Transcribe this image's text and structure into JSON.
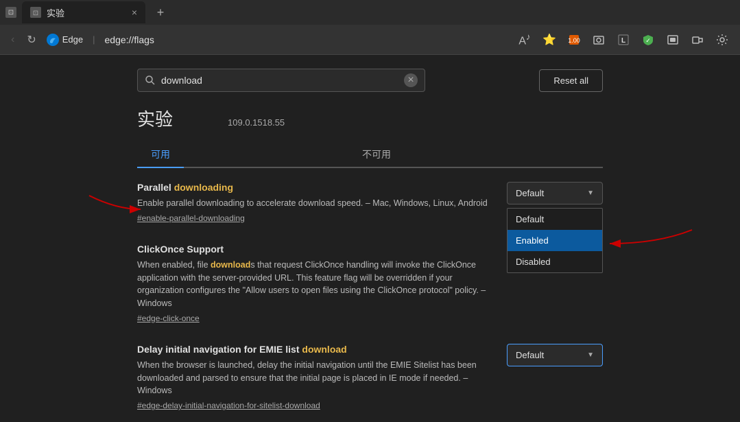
{
  "titleBar": {
    "tabTitle": "实验",
    "closeBtn": "×",
    "newTabBtn": "+"
  },
  "addressBar": {
    "edgeLogo": "Edge",
    "separator": "|",
    "url": "edge://flags",
    "backBtn": "‹",
    "refreshBtn": "↺"
  },
  "toolbar": {
    "readMode": "A",
    "favorites": "☆",
    "collections": "⚑",
    "screenshotIcon": "□",
    "adBlock": "L",
    "shieldIcon": "◆",
    "mediaIcon": "▤",
    "extensionsIcon": "🧩",
    "settingsIcon": "⚙",
    "badgeText": "1.00"
  },
  "search": {
    "placeholder": "download",
    "value": "download",
    "resetLabel": "Reset all"
  },
  "page": {
    "title": "实验",
    "version": "109.0.1518.55"
  },
  "tabs": [
    {
      "label": "可用",
      "active": true
    },
    {
      "label": "不可用",
      "active": false
    }
  ],
  "features": [
    {
      "id": "parallel-downloading",
      "titlePrefix": "Parallel ",
      "titleHighlight": "downloading",
      "description": "Enable parallel downloading to accelerate download speed. – Mac, Windows, Linux, Android",
      "link": "#enable-parallel-downloading",
      "control": {
        "selected": "Default",
        "options": [
          "Default",
          "Enabled",
          "Disabled"
        ],
        "open": true,
        "activeOption": "Enabled"
      }
    },
    {
      "id": "clickonce",
      "titlePrefix": "ClickOnce Support",
      "titleHighlight": "",
      "descPrefix": "When enabled, file ",
      "descHighlight": "download",
      "descSuffix": "s that request ClickOnce handling will invoke the ClickOnce application with the server-provided URL. This feature flag will be overridden if your organization configures the \"Allow users to open files using the ClickOnce protocol\" policy. – Windows",
      "link": "#edge-click-once",
      "control": {
        "selected": "Default",
        "options": [
          "Default",
          "Enabled",
          "Disabled"
        ],
        "open": false
      }
    },
    {
      "id": "emie-list",
      "titlePrefix": "Delay initial navigation for EMIE list ",
      "titleHighlight": "download",
      "description": "When the browser is launched, delay the initial navigation until the EMIE Sitelist has been downloaded and parsed to ensure that the initial page is placed in IE mode if needed. – Windows",
      "link": "#edge-delay-initial-navigation-for-sitelist-download",
      "control": {
        "selected": "Default",
        "options": [
          "Default",
          "Enabled",
          "Disabled"
        ],
        "open": false
      }
    }
  ],
  "colors": {
    "accent": "#4a9eff",
    "highlight": "#e8b84b",
    "dropdownActive": "#0c5a9e",
    "arrowRed": "#cc0000"
  }
}
